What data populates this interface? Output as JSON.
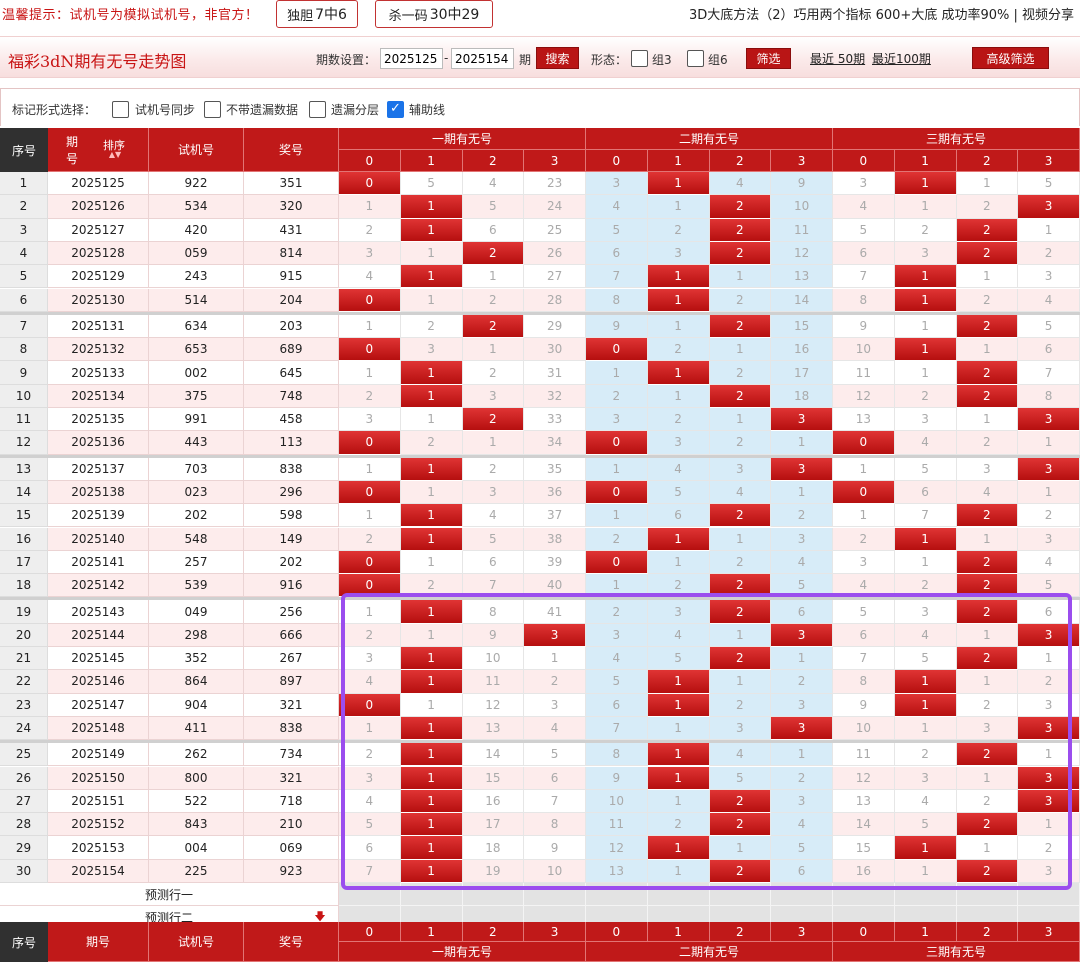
{
  "notice": {
    "tip": "温馨提示：试机号为模拟试机号，非官方！",
    "dudan_label": "独胆",
    "dudan_value": "7中6",
    "shayima_label": "杀一码",
    "shayima_value": "30中29",
    "right_text": "3D大底方法（2）巧用两个指标 600+大底 成功率90% | 视频分享"
  },
  "titlebar": {
    "title": "福彩3dN期有无号走势图",
    "period_label": "期数设置：",
    "period_start": "2025125",
    "dash": "-",
    "period_end": "2025154",
    "period_suffix": "期",
    "search_label": "搜索",
    "shape_label": "形态：",
    "group3_label": "组3",
    "group6_label": "组6",
    "filter_label": "筛选",
    "recent50": "最近 50期",
    "recent100": "最近100期",
    "advanced_label": "高级筛选"
  },
  "options": {
    "label": "标记形式选择：",
    "items": [
      {
        "label": "试机号同步",
        "checked": false
      },
      {
        "label": "不带遗漏数据",
        "checked": false
      },
      {
        "label": "遗漏分层",
        "checked": false
      },
      {
        "label": "辅助线",
        "checked": true
      }
    ],
    "check_glyph": "✓"
  },
  "header": {
    "seq": "序号",
    "issue": "期号",
    "issue_top": "期",
    "issue_bottom": "号",
    "sort": "排序",
    "sort_arrows": "▲▼",
    "trial": "试机号",
    "prize": "奖号",
    "groups": [
      "一期有无号",
      "二期有无号",
      "三期有无号"
    ],
    "digits": [
      "0",
      "1",
      "2",
      "3"
    ]
  },
  "rows": [
    {
      "seq": "1",
      "issue": "2025125",
      "trial": "922",
      "prize": "351",
      "g": [
        [
          "0",
          "5",
          "4",
          "23"
        ],
        [
          "3",
          "1",
          "4",
          "9"
        ],
        [
          "3",
          "1",
          "1",
          "5"
        ]
      ],
      "h": [
        [
          1,
          0,
          0,
          0
        ],
        [
          0,
          1,
          0,
          0
        ],
        [
          0,
          1,
          0,
          0
        ]
      ]
    },
    {
      "seq": "2",
      "issue": "2025126",
      "trial": "534",
      "prize": "320",
      "g": [
        [
          "1",
          "1",
          "5",
          "24"
        ],
        [
          "4",
          "1",
          "2",
          "10"
        ],
        [
          "4",
          "1",
          "2",
          "3"
        ]
      ],
      "h": [
        [
          0,
          1,
          0,
          0
        ],
        [
          0,
          0,
          1,
          0
        ],
        [
          0,
          0,
          0,
          1
        ]
      ]
    },
    {
      "seq": "3",
      "issue": "2025127",
      "trial": "420",
      "prize": "431",
      "g": [
        [
          "2",
          "1",
          "6",
          "25"
        ],
        [
          "5",
          "2",
          "2",
          "11"
        ],
        [
          "5",
          "2",
          "2",
          "1"
        ]
      ],
      "h": [
        [
          0,
          1,
          0,
          0
        ],
        [
          0,
          0,
          1,
          0
        ],
        [
          0,
          0,
          1,
          0
        ]
      ]
    },
    {
      "seq": "4",
      "issue": "2025128",
      "trial": "059",
      "prize": "814",
      "g": [
        [
          "3",
          "1",
          "2",
          "26"
        ],
        [
          "6",
          "3",
          "2",
          "12"
        ],
        [
          "6",
          "3",
          "2",
          "2"
        ]
      ],
      "h": [
        [
          0,
          0,
          1,
          0
        ],
        [
          0,
          0,
          1,
          0
        ],
        [
          0,
          0,
          1,
          0
        ]
      ]
    },
    {
      "seq": "5",
      "issue": "2025129",
      "trial": "243",
      "prize": "915",
      "g": [
        [
          "4",
          "1",
          "1",
          "27"
        ],
        [
          "7",
          "1",
          "1",
          "13"
        ],
        [
          "7",
          "1",
          "1",
          "3"
        ]
      ],
      "h": [
        [
          0,
          1,
          0,
          0
        ],
        [
          0,
          1,
          0,
          0
        ],
        [
          0,
          1,
          0,
          0
        ]
      ]
    },
    {
      "seq": "6",
      "issue": "2025130",
      "trial": "514",
      "prize": "204",
      "g": [
        [
          "0",
          "1",
          "2",
          "28"
        ],
        [
          "8",
          "1",
          "2",
          "14"
        ],
        [
          "8",
          "1",
          "2",
          "4"
        ]
      ],
      "h": [
        [
          1,
          0,
          0,
          0
        ],
        [
          0,
          1,
          0,
          0
        ],
        [
          0,
          1,
          0,
          0
        ]
      ]
    },
    {
      "seq": "7",
      "issue": "2025131",
      "trial": "634",
      "prize": "203",
      "g": [
        [
          "1",
          "2",
          "2",
          "29"
        ],
        [
          "9",
          "1",
          "2",
          "15"
        ],
        [
          "9",
          "1",
          "2",
          "5"
        ]
      ],
      "h": [
        [
          0,
          0,
          1,
          0
        ],
        [
          0,
          0,
          1,
          0
        ],
        [
          0,
          0,
          1,
          0
        ]
      ]
    },
    {
      "seq": "8",
      "issue": "2025132",
      "trial": "653",
      "prize": "689",
      "g": [
        [
          "0",
          "3",
          "1",
          "30"
        ],
        [
          "0",
          "2",
          "1",
          "16"
        ],
        [
          "10",
          "1",
          "1",
          "6"
        ]
      ],
      "h": [
        [
          1,
          0,
          0,
          0
        ],
        [
          1,
          0,
          0,
          0
        ],
        [
          0,
          1,
          0,
          0
        ]
      ]
    },
    {
      "seq": "9",
      "issue": "2025133",
      "trial": "002",
      "prize": "645",
      "g": [
        [
          "1",
          "1",
          "2",
          "31"
        ],
        [
          "1",
          "1",
          "2",
          "17"
        ],
        [
          "11",
          "1",
          "2",
          "7"
        ]
      ],
      "h": [
        [
          0,
          1,
          0,
          0
        ],
        [
          0,
          1,
          0,
          0
        ],
        [
          0,
          0,
          1,
          0
        ]
      ]
    },
    {
      "seq": "10",
      "issue": "2025134",
      "trial": "375",
      "prize": "748",
      "g": [
        [
          "2",
          "1",
          "3",
          "32"
        ],
        [
          "2",
          "1",
          "2",
          "18"
        ],
        [
          "12",
          "2",
          "2",
          "8"
        ]
      ],
      "h": [
        [
          0,
          1,
          0,
          0
        ],
        [
          0,
          0,
          1,
          0
        ],
        [
          0,
          0,
          1,
          0
        ]
      ]
    },
    {
      "seq": "11",
      "issue": "2025135",
      "trial": "991",
      "prize": "458",
      "g": [
        [
          "3",
          "1",
          "2",
          "33"
        ],
        [
          "3",
          "2",
          "1",
          "3"
        ],
        [
          "13",
          "3",
          "1",
          "3"
        ]
      ],
      "h": [
        [
          0,
          0,
          1,
          0
        ],
        [
          0,
          0,
          0,
          1
        ],
        [
          0,
          0,
          0,
          1
        ]
      ]
    },
    {
      "seq": "12",
      "issue": "2025136",
      "trial": "443",
      "prize": "113",
      "g": [
        [
          "0",
          "2",
          "1",
          "34"
        ],
        [
          "0",
          "3",
          "2",
          "1"
        ],
        [
          "0",
          "4",
          "2",
          "1"
        ]
      ],
      "h": [
        [
          1,
          0,
          0,
          0
        ],
        [
          1,
          0,
          0,
          0
        ],
        [
          1,
          0,
          0,
          0
        ]
      ]
    },
    {
      "seq": "13",
      "issue": "2025137",
      "trial": "703",
      "prize": "838",
      "g": [
        [
          "1",
          "1",
          "2",
          "35"
        ],
        [
          "1",
          "4",
          "3",
          "3"
        ],
        [
          "1",
          "5",
          "3",
          "3"
        ]
      ],
      "h": [
        [
          0,
          1,
          0,
          0
        ],
        [
          0,
          0,
          0,
          1
        ],
        [
          0,
          0,
          0,
          1
        ]
      ]
    },
    {
      "seq": "14",
      "issue": "2025138",
      "trial": "023",
      "prize": "296",
      "g": [
        [
          "0",
          "1",
          "3",
          "36"
        ],
        [
          "0",
          "5",
          "4",
          "1"
        ],
        [
          "0",
          "6",
          "4",
          "1"
        ]
      ],
      "h": [
        [
          1,
          0,
          0,
          0
        ],
        [
          1,
          0,
          0,
          0
        ],
        [
          1,
          0,
          0,
          0
        ]
      ]
    },
    {
      "seq": "15",
      "issue": "2025139",
      "trial": "202",
      "prize": "598",
      "g": [
        [
          "1",
          "1",
          "4",
          "37"
        ],
        [
          "1",
          "6",
          "2",
          "2"
        ],
        [
          "1",
          "7",
          "2",
          "2"
        ]
      ],
      "h": [
        [
          0,
          1,
          0,
          0
        ],
        [
          0,
          0,
          1,
          0
        ],
        [
          0,
          0,
          1,
          0
        ]
      ]
    },
    {
      "seq": "16",
      "issue": "2025140",
      "trial": "548",
      "prize": "149",
      "g": [
        [
          "2",
          "1",
          "5",
          "38"
        ],
        [
          "2",
          "1",
          "1",
          "3"
        ],
        [
          "2",
          "1",
          "1",
          "3"
        ]
      ],
      "h": [
        [
          0,
          1,
          0,
          0
        ],
        [
          0,
          1,
          0,
          0
        ],
        [
          0,
          1,
          0,
          0
        ]
      ]
    },
    {
      "seq": "17",
      "issue": "2025141",
      "trial": "257",
      "prize": "202",
      "g": [
        [
          "0",
          "1",
          "6",
          "39"
        ],
        [
          "0",
          "1",
          "2",
          "4"
        ],
        [
          "3",
          "1",
          "2",
          "4"
        ]
      ],
      "h": [
        [
          1,
          0,
          0,
          0
        ],
        [
          1,
          0,
          0,
          0
        ],
        [
          0,
          0,
          1,
          0
        ]
      ]
    },
    {
      "seq": "18",
      "issue": "2025142",
      "trial": "539",
      "prize": "916",
      "g": [
        [
          "0",
          "2",
          "7",
          "40"
        ],
        [
          "1",
          "2",
          "2",
          "5"
        ],
        [
          "4",
          "2",
          "2",
          "5"
        ]
      ],
      "h": [
        [
          1,
          0,
          0,
          0
        ],
        [
          0,
          0,
          1,
          0
        ],
        [
          0,
          0,
          1,
          0
        ]
      ]
    },
    {
      "seq": "19",
      "issue": "2025143",
      "trial": "049",
      "prize": "256",
      "g": [
        [
          "1",
          "1",
          "8",
          "41"
        ],
        [
          "2",
          "3",
          "2",
          "6"
        ],
        [
          "5",
          "3",
          "2",
          "6"
        ]
      ],
      "h": [
        [
          0,
          1,
          0,
          0
        ],
        [
          0,
          0,
          1,
          0
        ],
        [
          0,
          0,
          1,
          0
        ]
      ]
    },
    {
      "seq": "20",
      "issue": "2025144",
      "trial": "298",
      "prize": "666",
      "g": [
        [
          "2",
          "1",
          "9",
          "3"
        ],
        [
          "3",
          "4",
          "1",
          "3"
        ],
        [
          "6",
          "4",
          "1",
          "3"
        ]
      ],
      "h": [
        [
          0,
          0,
          0,
          1
        ],
        [
          0,
          0,
          0,
          1
        ],
        [
          0,
          0,
          0,
          1
        ]
      ]
    },
    {
      "seq": "21",
      "issue": "2025145",
      "trial": "352",
      "prize": "267",
      "g": [
        [
          "3",
          "1",
          "10",
          "1"
        ],
        [
          "4",
          "5",
          "2",
          "1"
        ],
        [
          "7",
          "5",
          "2",
          "1"
        ]
      ],
      "h": [
        [
          0,
          1,
          0,
          0
        ],
        [
          0,
          0,
          1,
          0
        ],
        [
          0,
          0,
          1,
          0
        ]
      ]
    },
    {
      "seq": "22",
      "issue": "2025146",
      "trial": "864",
      "prize": "897",
      "g": [
        [
          "4",
          "1",
          "11",
          "2"
        ],
        [
          "5",
          "1",
          "1",
          "2"
        ],
        [
          "8",
          "1",
          "1",
          "2"
        ]
      ],
      "h": [
        [
          0,
          1,
          0,
          0
        ],
        [
          0,
          1,
          0,
          0
        ],
        [
          0,
          1,
          0,
          0
        ]
      ]
    },
    {
      "seq": "23",
      "issue": "2025147",
      "trial": "904",
      "prize": "321",
      "g": [
        [
          "0",
          "1",
          "12",
          "3"
        ],
        [
          "6",
          "1",
          "2",
          "3"
        ],
        [
          "9",
          "1",
          "2",
          "3"
        ]
      ],
      "h": [
        [
          1,
          0,
          0,
          0
        ],
        [
          0,
          1,
          0,
          0
        ],
        [
          0,
          1,
          0,
          0
        ]
      ]
    },
    {
      "seq": "24",
      "issue": "2025148",
      "trial": "411",
      "prize": "838",
      "g": [
        [
          "1",
          "1",
          "13",
          "4"
        ],
        [
          "7",
          "1",
          "3",
          "3"
        ],
        [
          "10",
          "1",
          "3",
          "3"
        ]
      ],
      "h": [
        [
          0,
          1,
          0,
          0
        ],
        [
          0,
          0,
          0,
          1
        ],
        [
          0,
          0,
          0,
          1
        ]
      ]
    },
    {
      "seq": "25",
      "issue": "2025149",
      "trial": "262",
      "prize": "734",
      "g": [
        [
          "2",
          "1",
          "14",
          "5"
        ],
        [
          "8",
          "1",
          "4",
          "1"
        ],
        [
          "11",
          "2",
          "2",
          "1"
        ]
      ],
      "h": [
        [
          0,
          1,
          0,
          0
        ],
        [
          0,
          1,
          0,
          0
        ],
        [
          0,
          0,
          1,
          0
        ]
      ]
    },
    {
      "seq": "26",
      "issue": "2025150",
      "trial": "800",
      "prize": "321",
      "g": [
        [
          "3",
          "1",
          "15",
          "6"
        ],
        [
          "9",
          "1",
          "5",
          "2"
        ],
        [
          "12",
          "3",
          "1",
          "3"
        ]
      ],
      "h": [
        [
          0,
          1,
          0,
          0
        ],
        [
          0,
          1,
          0,
          0
        ],
        [
          0,
          0,
          0,
          1
        ]
      ]
    },
    {
      "seq": "27",
      "issue": "2025151",
      "trial": "522",
      "prize": "718",
      "g": [
        [
          "4",
          "1",
          "16",
          "7"
        ],
        [
          "10",
          "1",
          "2",
          "3"
        ],
        [
          "13",
          "4",
          "2",
          "3"
        ]
      ],
      "h": [
        [
          0,
          1,
          0,
          0
        ],
        [
          0,
          0,
          1,
          0
        ],
        [
          0,
          0,
          0,
          1
        ]
      ]
    },
    {
      "seq": "28",
      "issue": "2025152",
      "trial": "843",
      "prize": "210",
      "g": [
        [
          "5",
          "1",
          "17",
          "8"
        ],
        [
          "11",
          "2",
          "2",
          "4"
        ],
        [
          "14",
          "5",
          "2",
          "1"
        ]
      ],
      "h": [
        [
          0,
          1,
          0,
          0
        ],
        [
          0,
          0,
          1,
          0
        ],
        [
          0,
          0,
          1,
          0
        ]
      ]
    },
    {
      "seq": "29",
      "issue": "2025153",
      "trial": "004",
      "prize": "069",
      "g": [
        [
          "6",
          "1",
          "18",
          "9"
        ],
        [
          "12",
          "1",
          "1",
          "5"
        ],
        [
          "15",
          "1",
          "1",
          "2"
        ]
      ],
      "h": [
        [
          0,
          1,
          0,
          0
        ],
        [
          0,
          1,
          0,
          0
        ],
        [
          0,
          1,
          0,
          0
        ]
      ]
    },
    {
      "seq": "30",
      "issue": "2025154",
      "trial": "225",
      "prize": "923",
      "g": [
        [
          "7",
          "1",
          "19",
          "10"
        ],
        [
          "13",
          "1",
          "2",
          "6"
        ],
        [
          "16",
          "1",
          "2",
          "3"
        ]
      ],
      "h": [
        [
          0,
          1,
          0,
          0
        ],
        [
          0,
          0,
          1,
          0
        ],
        [
          0,
          0,
          1,
          0
        ]
      ]
    }
  ],
  "predict": {
    "row1": "预测行一",
    "row2": "预测行二",
    "arrow": "🡇"
  },
  "colors": {
    "hit_red": "#c91a1a",
    "header_red": "#c01919",
    "miss_blue": "#d7ecf8",
    "highlight": "#9b4dee"
  }
}
